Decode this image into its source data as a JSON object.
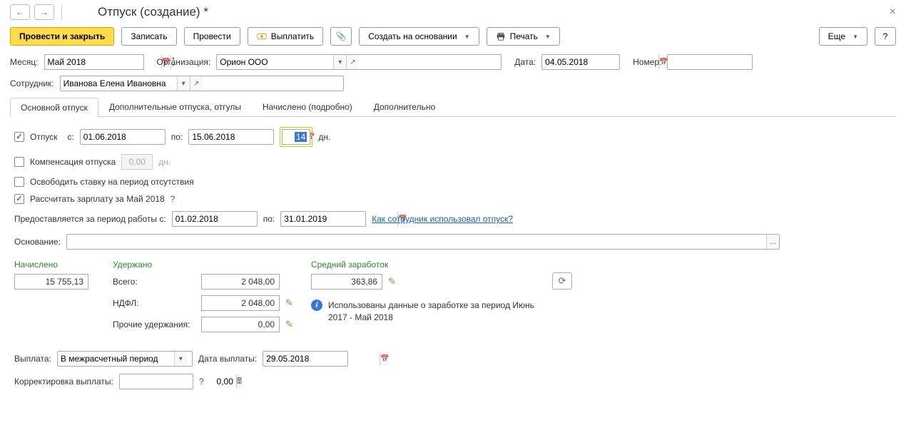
{
  "header": {
    "title": "Отпуск (создание) *"
  },
  "toolbar": {
    "post_close": "Провести и закрыть",
    "save": "Записать",
    "post": "Провести",
    "pay": "Выплатить",
    "create_based": "Создать на основании",
    "print": "Печать",
    "more": "Еще"
  },
  "fields": {
    "month_label": "Месяц:",
    "month_value": "Май 2018",
    "org_label": "Организация:",
    "org_value": "Орион ООО",
    "date_label": "Дата:",
    "date_value": "04.05.2018",
    "number_label": "Номер:",
    "number_value": "",
    "employee_label": "Сотрудник:",
    "employee_value": "Иванова Елена Ивановна"
  },
  "tabs": {
    "main": "Основной отпуск",
    "extra": "Дополнительные отпуска, отгулы",
    "accrued": "Начислено (подробно)",
    "additional": "Дополнительно"
  },
  "vacation": {
    "chk_label": "Отпуск",
    "from_label": "с:",
    "from_value": "01.06.2018",
    "to_label": "по:",
    "to_value": "15.06.2018",
    "days_value": "14",
    "days_unit": "дн.",
    "compensation_label": "Компенсация отпуска",
    "compensation_value": "0,00",
    "compensation_unit": "дн.",
    "release_label": "Освободить ставку на период отсутствия",
    "calc_salary_label": "Рассчитать зарплату за Май 2018",
    "period_label": "Предоставляется за период работы с:",
    "period_from": "01.02.2018",
    "period_to_label": "по:",
    "period_to": "31.01.2019",
    "usage_link": "Как сотрудник использовал отпуск?",
    "basis_label": "Основание:",
    "basis_value": ""
  },
  "calc": {
    "accrued_head": "Начислено",
    "accrued_value": "15 755,13",
    "withheld_head": "Удержано",
    "total_label": "Всего:",
    "total_value": "2 048,00",
    "ndfl_label": "НДФЛ:",
    "ndfl_value": "2 048,00",
    "other_label": "Прочие удержания:",
    "other_value": "0,00",
    "avg_head": "Средний заработок",
    "avg_value": "363,86",
    "info_text": "Использованы данные о заработке за период Июнь 2017 - Май 2018"
  },
  "payout": {
    "label": "Выплата:",
    "value": "В межрасчетный период",
    "date_label": "Дата выплаты:",
    "date_value": "29.05.2018",
    "correction_label": "Корректировка выплаты:",
    "correction_value": "0,00"
  }
}
